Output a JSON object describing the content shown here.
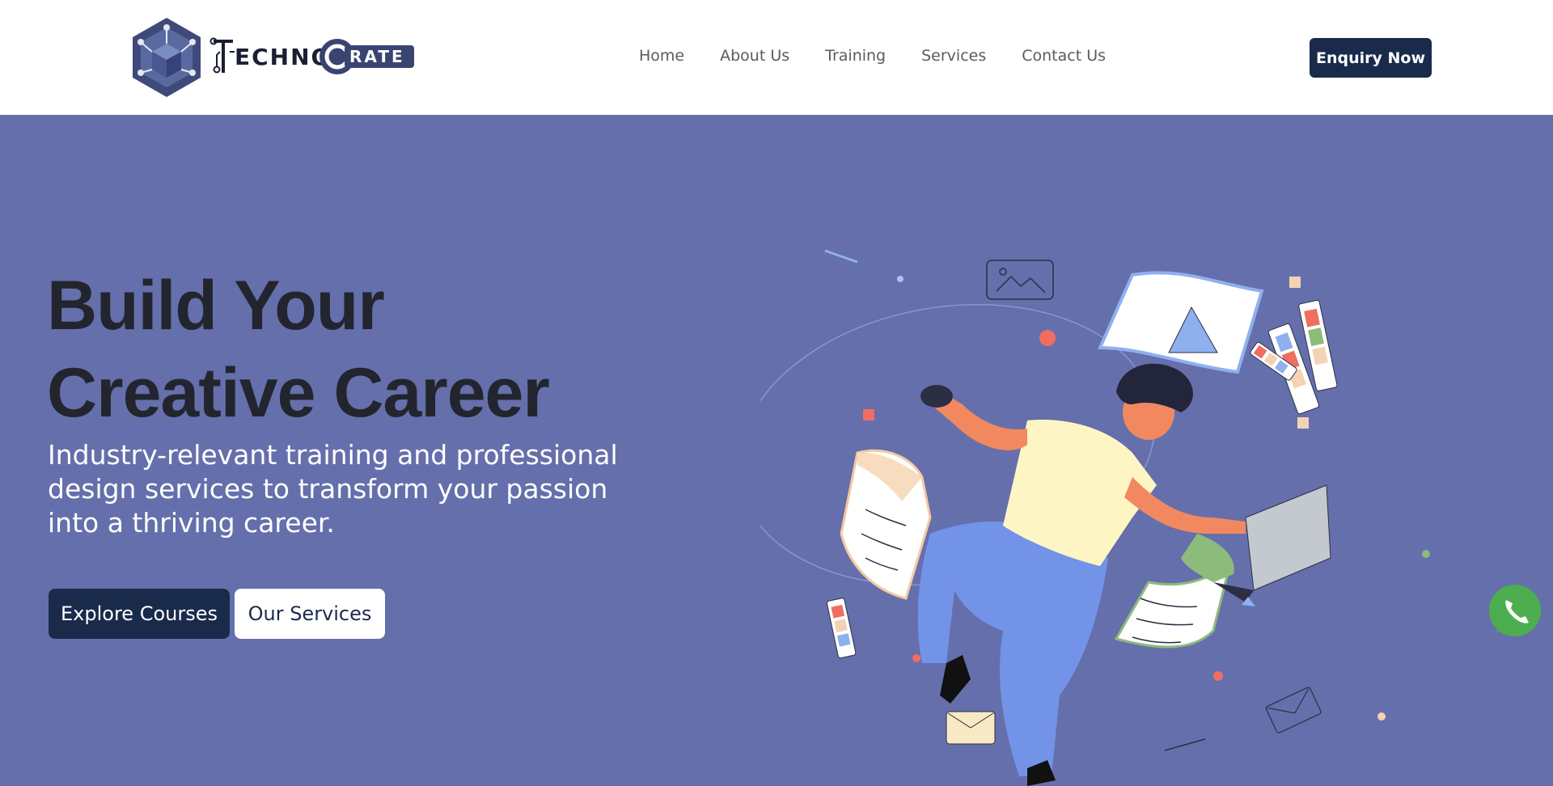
{
  "header": {
    "logo_text": "TECHNOCRATE",
    "nav": [
      "Home",
      "About Us",
      "Training",
      "Services",
      "Contact Us"
    ],
    "enquiry_label": "Enquiry Now"
  },
  "hero": {
    "title_line1": "Build Your",
    "title_line2": "Creative Career",
    "description": "Industry-relevant training and professional design services to transform your passion into a thriving career.",
    "primary_button": "Explore Courses",
    "secondary_button": "Our Services"
  },
  "floating": {
    "whatsapp_icon": "whatsapp-icon"
  },
  "colors": {
    "hero_bg": "#656fab",
    "navy": "#1a2a4b",
    "whatsapp": "#4cae4f"
  }
}
